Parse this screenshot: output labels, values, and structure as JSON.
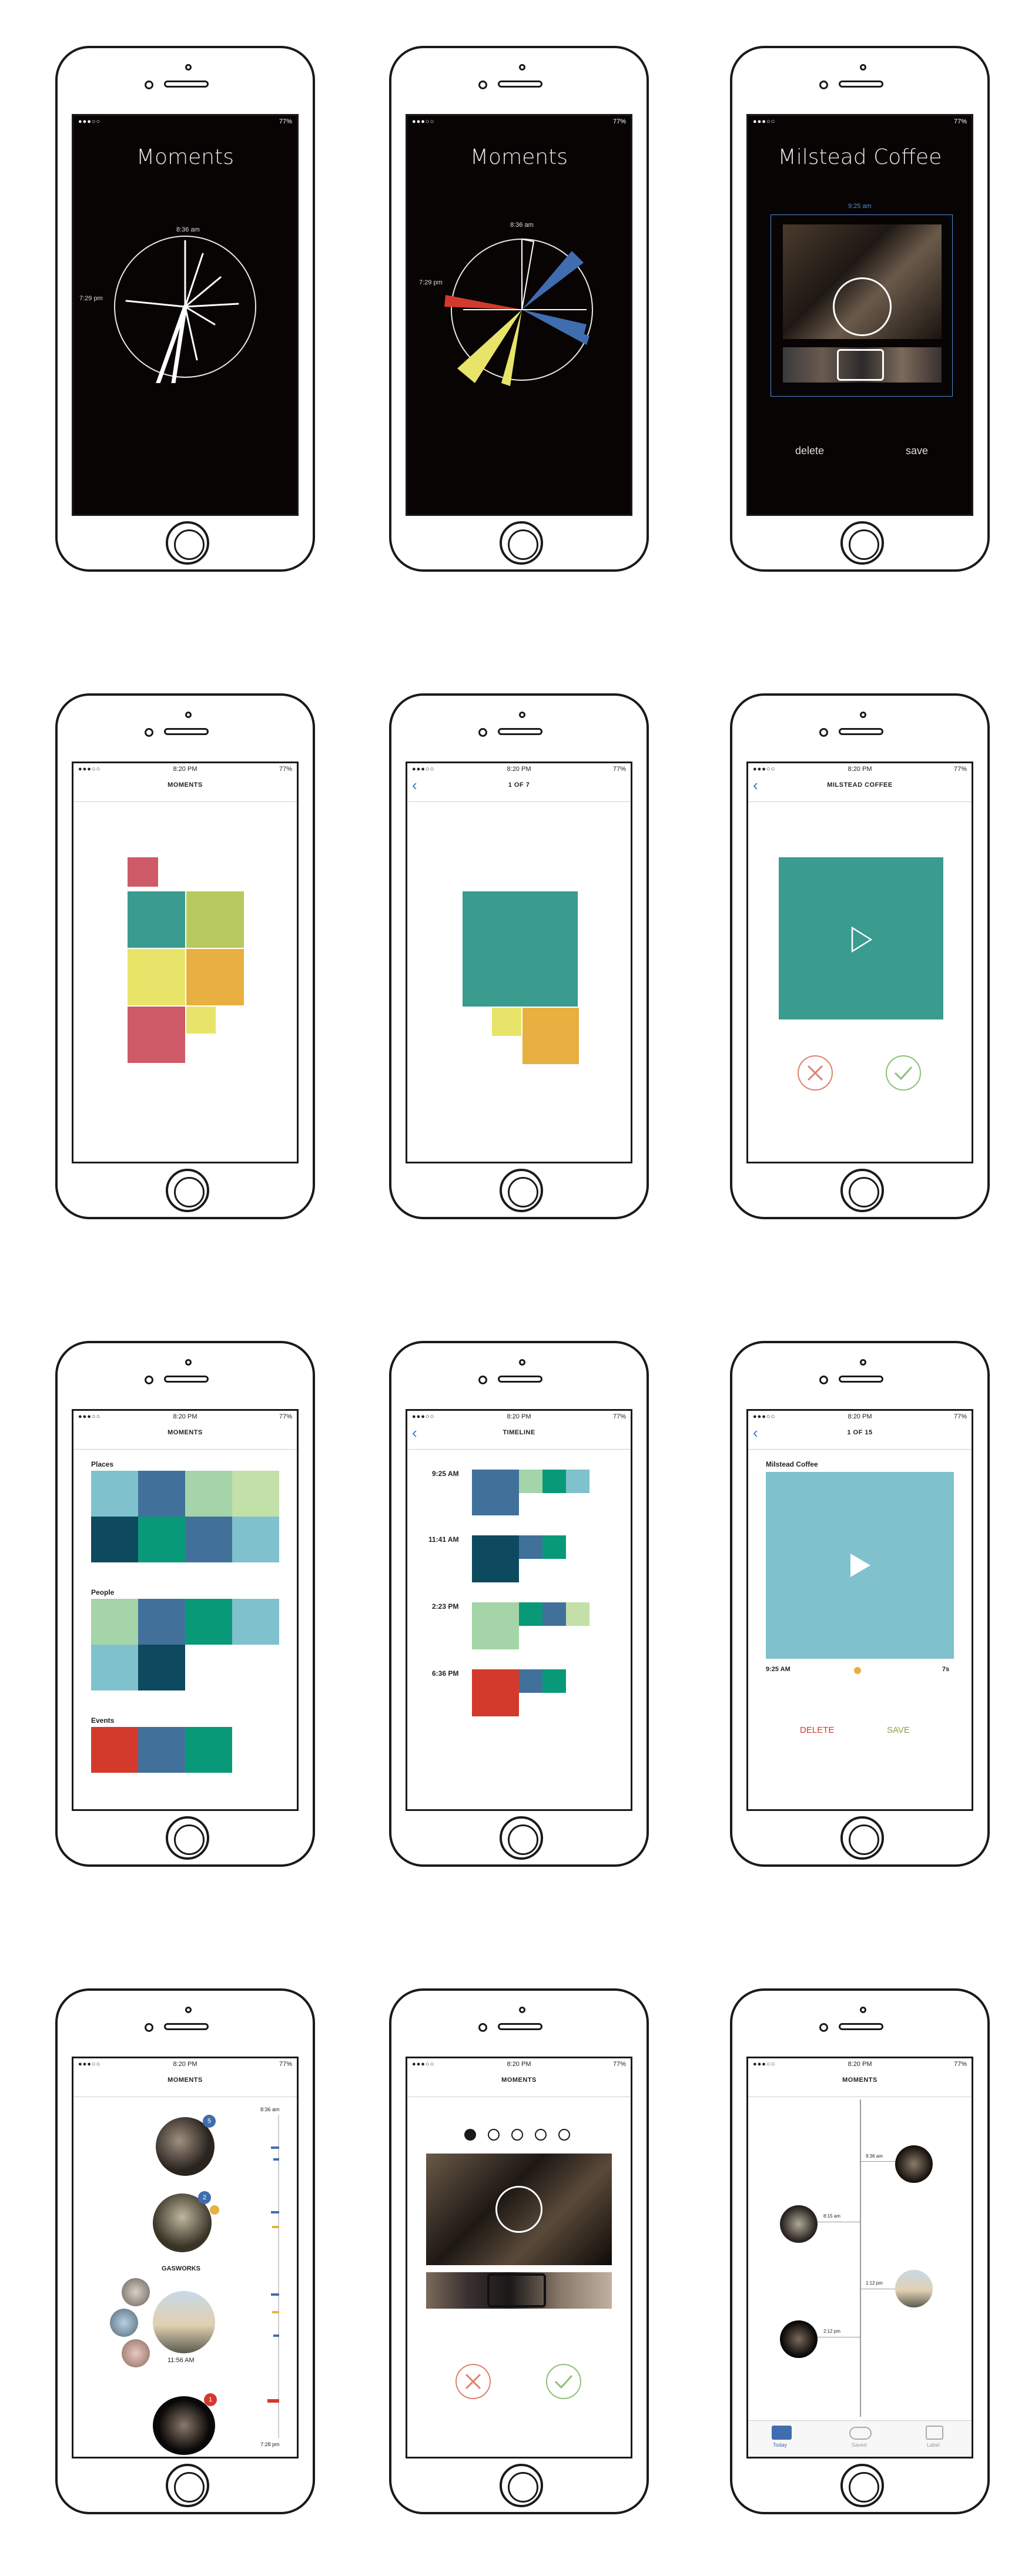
{
  "status": {
    "signal": "●●●○○",
    "time": "8:20 PM",
    "battery": "77%",
    "battery_dark": "77%"
  },
  "s1": {
    "title": "Moments",
    "t_top": "8:36 am",
    "t_left": "7:29 pm"
  },
  "s2": {
    "title": "Moments",
    "t_top": "8:36 am",
    "t_left": "7:29 pm"
  },
  "s3": {
    "title": "Milstead Coffee",
    "time": "9:25 am",
    "delete": "delete",
    "save": "save"
  },
  "s4": {
    "nav": "MOMENTS"
  },
  "s5": {
    "nav": "1 OF 7"
  },
  "s6": {
    "nav": "MILSTEAD COFFEE"
  },
  "s7": {
    "nav": "MOMENTS",
    "places": "Places",
    "people": "People",
    "events": "Events"
  },
  "s8": {
    "nav": "TIMELINE",
    "times": [
      "9:25 AM",
      "11:41 AM",
      "2:23 PM",
      "6:36 PM"
    ]
  },
  "s9": {
    "nav": "1 OF 15",
    "title": "Milstead Coffee",
    "start": "9:25 AM",
    "dur": "7s",
    "delete": "DELETE",
    "save": "SAVE"
  },
  "s10": {
    "nav": "MOMENTS",
    "badge1": "5",
    "badge2": "2",
    "badge3": "1",
    "place": "GASWORKS",
    "time": "11:56 AM",
    "scale_top": "8:36 am",
    "scale_bottom": "7:28 pm"
  },
  "s11": {
    "nav": "MOMENTS"
  },
  "s12": {
    "nav": "MOMENTS",
    "t1": "9:36 am",
    "t2": "8:15 am",
    "t3": "1:12 pm",
    "t4": "2:12 pm",
    "tabs": [
      "Today",
      "Saved",
      "Label"
    ]
  },
  "colors": {
    "teal": "#3a9b8f",
    "green_dark": "#089a78",
    "navy": "#0e4a5f",
    "steel": "#41719a",
    "sky": "#7fc1cd",
    "mint": "#a4d4a8",
    "lime": "#b8c95f",
    "yellow": "#e8e46a",
    "orange": "#e8b040",
    "red": "#d33a2c",
    "rose": "#ce5a68",
    "blue": "#3f6db0"
  }
}
